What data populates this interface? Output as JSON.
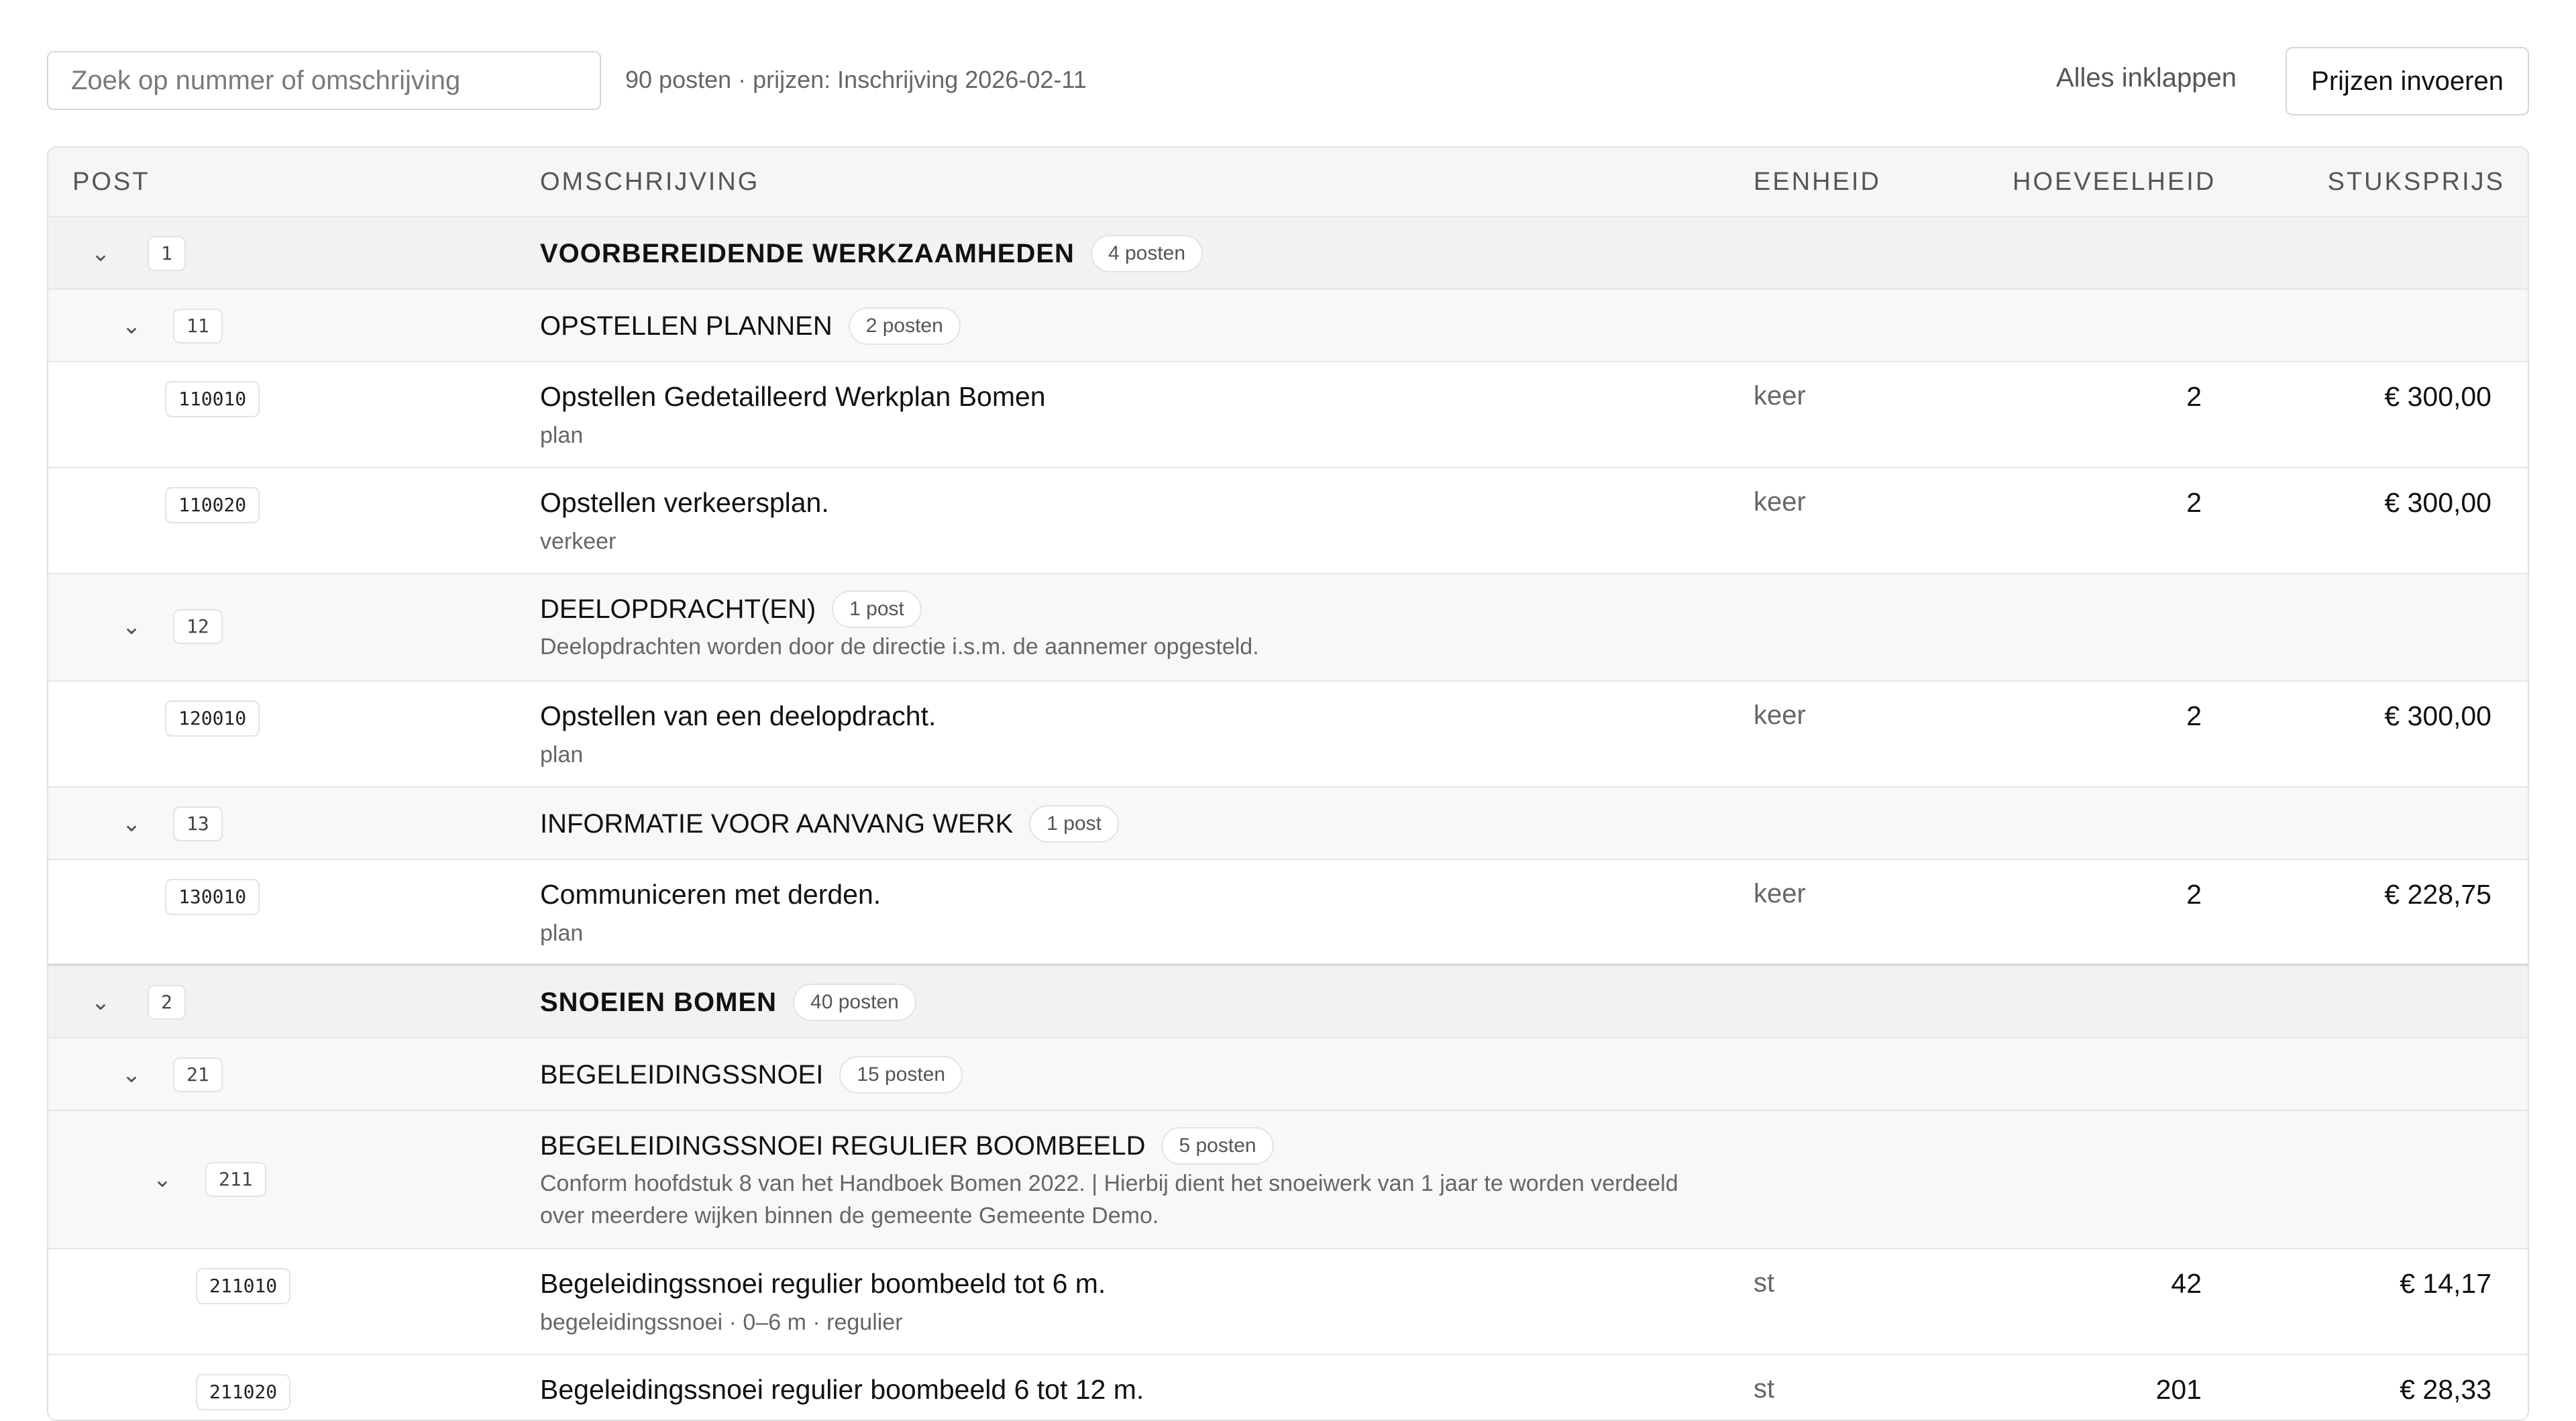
{
  "toolbar": {
    "search_placeholder": "Zoek op nummer of omschrijving",
    "meta": "90 posten · prijzen: Inschrijving 2026-02-11",
    "collapse_all": "Alles inklappen",
    "enter_prices": "Prijzen invoeren"
  },
  "columns": {
    "post": "POST",
    "description": "OMSCHRIJVING",
    "unit": "EENHEID",
    "quantity": "HOEVEELHEID",
    "unit_price": "STUKSPRIJS"
  },
  "icons": {
    "chevron": "chevron-down-icon"
  },
  "rows": [
    {
      "kind": "group1",
      "number": "1",
      "title": "VOORBEREIDENDE WERKZAAMHEDEN",
      "count": "4 posten"
    },
    {
      "kind": "group2",
      "number": "11",
      "title": "OPSTELLEN PLANNEN",
      "count": "2 posten"
    },
    {
      "kind": "item",
      "code": "110010",
      "description": "Opstellen Gedetailleerd Werkplan Bomen",
      "sub": "plan",
      "unit": "keer",
      "quantity": "2",
      "price": "€ 300,00"
    },
    {
      "kind": "item",
      "code": "110020",
      "description": "Opstellen verkeersplan.",
      "sub": "verkeer",
      "unit": "keer",
      "quantity": "2",
      "price": "€ 300,00"
    },
    {
      "kind": "group2",
      "number": "12",
      "title": "DEELOPDRACHT(EN)",
      "count": "1 post",
      "note": "Deelopdrachten worden door de directie i.s.m. de aannemer opgesteld."
    },
    {
      "kind": "item",
      "code": "120010",
      "description": "Opstellen van een deelopdracht.",
      "sub": "plan",
      "unit": "keer",
      "quantity": "2",
      "price": "€ 300,00"
    },
    {
      "kind": "group2",
      "number": "13",
      "title": "INFORMATIE VOOR AANVANG WERK",
      "count": "1 post"
    },
    {
      "kind": "item",
      "code": "130010",
      "description": "Communiceren met derden.",
      "sub": "plan",
      "unit": "keer",
      "quantity": "2",
      "price": "€ 228,75"
    },
    {
      "kind": "group1",
      "number": "2",
      "title": "SNOEIEN BOMEN",
      "count": "40 posten"
    },
    {
      "kind": "group2",
      "number": "21",
      "title": "BEGELEIDINGSSNOEI",
      "count": "15 posten"
    },
    {
      "kind": "group3",
      "number": "211",
      "title": "BEGELEIDINGSSNOEI REGULIER BOOMBEELD",
      "count": "5 posten",
      "note": "Conform hoofdstuk 8 van het Handboek Bomen 2022. | Hierbij dient het snoeiwerk van 1 jaar te worden verdeeld over meerdere wijken binnen de gemeente Gemeente Demo."
    },
    {
      "kind": "item",
      "code": "211010",
      "description": "Begeleidingssnoei regulier boombeeld tot 6 m.",
      "sub": "begeleidingssnoei · 0–6 m · regulier",
      "unit": "st",
      "quantity": "42",
      "price": "€ 14,17"
    },
    {
      "kind": "item",
      "code": "211020",
      "description": "Begeleidingssnoei regulier boombeeld 6 tot 12 m.",
      "sub": "",
      "unit": "st",
      "quantity": "201",
      "price": "€ 28,33"
    }
  ]
}
